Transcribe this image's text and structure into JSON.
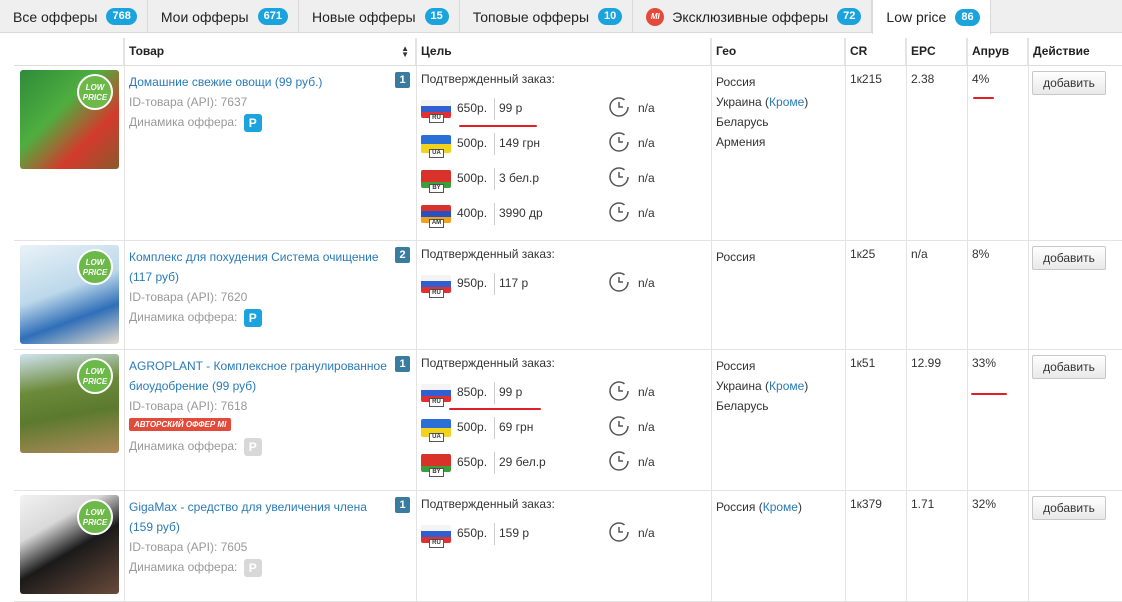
{
  "tabs": [
    {
      "label": "Все офферы",
      "count": "768"
    },
    {
      "label": "Мои офферы",
      "count": "671"
    },
    {
      "label": "Новые офферы",
      "count": "15"
    },
    {
      "label": "Топовые офферы",
      "count": "10"
    },
    {
      "label": "Эксклюзивные офферы",
      "count": "72",
      "icon_text": "MI"
    },
    {
      "label": "Low price",
      "count": "86"
    }
  ],
  "columns": {
    "product": "Товар",
    "goal": "Цель",
    "geo": "Гео",
    "cr": "CR",
    "epc": "EPC",
    "approve": "Апрув",
    "action": "Действие"
  },
  "common": {
    "goal_label": "Подтвержденный заказ:",
    "id_prefix": "ID-товара (API): ",
    "dynamics_label": "Динамика оффера:",
    "p_badge": "P",
    "na": "n/a",
    "add_button": "добавить",
    "low_price_line1": "LOW",
    "low_price_line2": "PRICE",
    "author_badge": "АВТОРСКИЙ ОФФЕР MI"
  },
  "colors": {
    "accent": "#1aa3dd",
    "link": "#2a7ab8",
    "low_price": "#6cb94a",
    "exclusive": "#e44a3a",
    "highlight": "#e21e26"
  },
  "offers": [
    {
      "title": "Домашние свежие овощи (99 руб.)",
      "number": "1",
      "id_text": "ID-товара (API): 7637",
      "dynamics_active": true,
      "goals": [
        {
          "flag": "RU",
          "local": "650р.",
          "foreign": "99 р"
        },
        {
          "flag": "UA",
          "local": "500р.",
          "foreign": "149 грн"
        },
        {
          "flag": "BY",
          "local": "500р.",
          "foreign": "3 бел.р"
        },
        {
          "flag": "AM",
          "local": "400р.",
          "foreign": "3990 др"
        }
      ],
      "geo": [
        "Россия",
        "Украина",
        "Беларусь",
        "Армения"
      ],
      "geo_note": "Кроме",
      "cr": "1к215",
      "epc": "2.38",
      "approve": "4%"
    },
    {
      "title": "Комплекс для похудения Система очищение (117 руб)",
      "number": "2",
      "id_text": "ID-товара (API): 7620",
      "dynamics_active": true,
      "goals": [
        {
          "flag": "RU",
          "local": "950р.",
          "foreign": "117 р"
        }
      ],
      "geo": [
        "Россия"
      ],
      "cr": "1к25",
      "epc": "n/a",
      "approve": "8%"
    },
    {
      "title": "AGROPLANT - Комплексное гранулированное биоудобрение (99 руб)",
      "number": "1",
      "id_text": "ID-товара (API): 7618",
      "dynamics_active": false,
      "author": true,
      "goals": [
        {
          "flag": "RU",
          "local": "850р.",
          "foreign": "99 р"
        },
        {
          "flag": "UA",
          "local": "500р.",
          "foreign": "69 грн"
        },
        {
          "flag": "BY",
          "local": "650р.",
          "foreign": "29 бел.р"
        }
      ],
      "geo": [
        "Россия",
        "Украина",
        "Беларусь"
      ],
      "geo_note": "Кроме",
      "cr": "1к51",
      "epc": "12.99",
      "approve": "33%"
    },
    {
      "title": "GigaMax - средство для увеличения члена (159 руб)",
      "number": "1",
      "id_text": "ID-товара (API): 7605",
      "dynamics_active": false,
      "goals": [
        {
          "flag": "RU",
          "local": "650р.",
          "foreign": "159 р"
        }
      ],
      "geo": [
        "Россия"
      ],
      "geo_note": "Кроме",
      "cr": "1к379",
      "epc": "1.71",
      "approve": "32%"
    }
  ]
}
